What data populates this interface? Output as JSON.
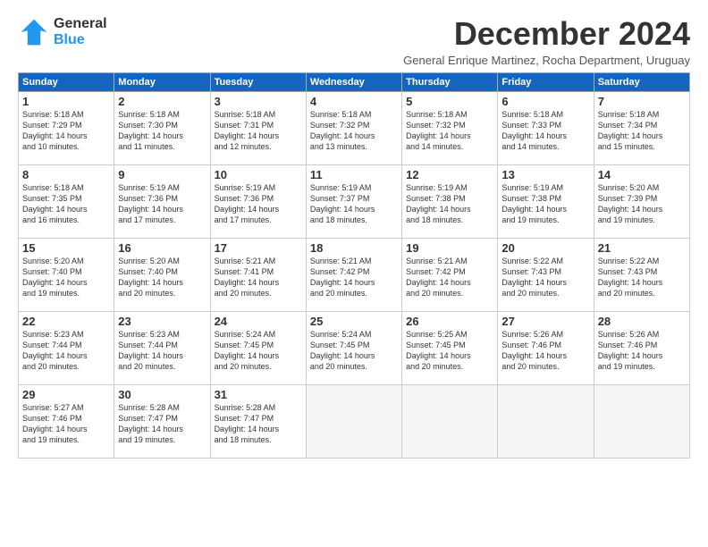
{
  "logo": {
    "general": "General",
    "blue": "Blue"
  },
  "title": "December 2024",
  "subtitle": "General Enrique Martinez, Rocha Department, Uruguay",
  "days_header": [
    "Sunday",
    "Monday",
    "Tuesday",
    "Wednesday",
    "Thursday",
    "Friday",
    "Saturday"
  ],
  "weeks": [
    [
      {
        "day": "1",
        "info": "Sunrise: 5:18 AM\nSunset: 7:29 PM\nDaylight: 14 hours\nand 10 minutes."
      },
      {
        "day": "2",
        "info": "Sunrise: 5:18 AM\nSunset: 7:30 PM\nDaylight: 14 hours\nand 11 minutes."
      },
      {
        "day": "3",
        "info": "Sunrise: 5:18 AM\nSunset: 7:31 PM\nDaylight: 14 hours\nand 12 minutes."
      },
      {
        "day": "4",
        "info": "Sunrise: 5:18 AM\nSunset: 7:32 PM\nDaylight: 14 hours\nand 13 minutes."
      },
      {
        "day": "5",
        "info": "Sunrise: 5:18 AM\nSunset: 7:32 PM\nDaylight: 14 hours\nand 14 minutes."
      },
      {
        "day": "6",
        "info": "Sunrise: 5:18 AM\nSunset: 7:33 PM\nDaylight: 14 hours\nand 14 minutes."
      },
      {
        "day": "7",
        "info": "Sunrise: 5:18 AM\nSunset: 7:34 PM\nDaylight: 14 hours\nand 15 minutes."
      }
    ],
    [
      {
        "day": "8",
        "info": "Sunrise: 5:18 AM\nSunset: 7:35 PM\nDaylight: 14 hours\nand 16 minutes."
      },
      {
        "day": "9",
        "info": "Sunrise: 5:19 AM\nSunset: 7:36 PM\nDaylight: 14 hours\nand 17 minutes."
      },
      {
        "day": "10",
        "info": "Sunrise: 5:19 AM\nSunset: 7:36 PM\nDaylight: 14 hours\nand 17 minutes."
      },
      {
        "day": "11",
        "info": "Sunrise: 5:19 AM\nSunset: 7:37 PM\nDaylight: 14 hours\nand 18 minutes."
      },
      {
        "day": "12",
        "info": "Sunrise: 5:19 AM\nSunset: 7:38 PM\nDaylight: 14 hours\nand 18 minutes."
      },
      {
        "day": "13",
        "info": "Sunrise: 5:19 AM\nSunset: 7:38 PM\nDaylight: 14 hours\nand 19 minutes."
      },
      {
        "day": "14",
        "info": "Sunrise: 5:20 AM\nSunset: 7:39 PM\nDaylight: 14 hours\nand 19 minutes."
      }
    ],
    [
      {
        "day": "15",
        "info": "Sunrise: 5:20 AM\nSunset: 7:40 PM\nDaylight: 14 hours\nand 19 minutes."
      },
      {
        "day": "16",
        "info": "Sunrise: 5:20 AM\nSunset: 7:40 PM\nDaylight: 14 hours\nand 20 minutes."
      },
      {
        "day": "17",
        "info": "Sunrise: 5:21 AM\nSunset: 7:41 PM\nDaylight: 14 hours\nand 20 minutes."
      },
      {
        "day": "18",
        "info": "Sunrise: 5:21 AM\nSunset: 7:42 PM\nDaylight: 14 hours\nand 20 minutes."
      },
      {
        "day": "19",
        "info": "Sunrise: 5:21 AM\nSunset: 7:42 PM\nDaylight: 14 hours\nand 20 minutes."
      },
      {
        "day": "20",
        "info": "Sunrise: 5:22 AM\nSunset: 7:43 PM\nDaylight: 14 hours\nand 20 minutes."
      },
      {
        "day": "21",
        "info": "Sunrise: 5:22 AM\nSunset: 7:43 PM\nDaylight: 14 hours\nand 20 minutes."
      }
    ],
    [
      {
        "day": "22",
        "info": "Sunrise: 5:23 AM\nSunset: 7:44 PM\nDaylight: 14 hours\nand 20 minutes."
      },
      {
        "day": "23",
        "info": "Sunrise: 5:23 AM\nSunset: 7:44 PM\nDaylight: 14 hours\nand 20 minutes."
      },
      {
        "day": "24",
        "info": "Sunrise: 5:24 AM\nSunset: 7:45 PM\nDaylight: 14 hours\nand 20 minutes."
      },
      {
        "day": "25",
        "info": "Sunrise: 5:24 AM\nSunset: 7:45 PM\nDaylight: 14 hours\nand 20 minutes."
      },
      {
        "day": "26",
        "info": "Sunrise: 5:25 AM\nSunset: 7:45 PM\nDaylight: 14 hours\nand 20 minutes."
      },
      {
        "day": "27",
        "info": "Sunrise: 5:26 AM\nSunset: 7:46 PM\nDaylight: 14 hours\nand 20 minutes."
      },
      {
        "day": "28",
        "info": "Sunrise: 5:26 AM\nSunset: 7:46 PM\nDaylight: 14 hours\nand 19 minutes."
      }
    ],
    [
      {
        "day": "29",
        "info": "Sunrise: 5:27 AM\nSunset: 7:46 PM\nDaylight: 14 hours\nand 19 minutes."
      },
      {
        "day": "30",
        "info": "Sunrise: 5:28 AM\nSunset: 7:47 PM\nDaylight: 14 hours\nand 19 minutes."
      },
      {
        "day": "31",
        "info": "Sunrise: 5:28 AM\nSunset: 7:47 PM\nDaylight: 14 hours\nand 18 minutes."
      },
      {
        "day": "",
        "info": ""
      },
      {
        "day": "",
        "info": ""
      },
      {
        "day": "",
        "info": ""
      },
      {
        "day": "",
        "info": ""
      }
    ]
  ]
}
